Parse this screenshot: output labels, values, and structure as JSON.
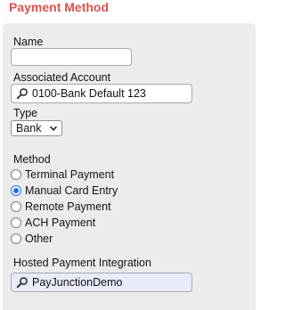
{
  "section": {
    "title": "Payment Method"
  },
  "fields": {
    "name_label": "Name",
    "name_value": "",
    "account_label": "Associated Account",
    "account_value": "0100-Bank Default 123",
    "type_label": "Type",
    "type_value": "Bank",
    "method_label": "Method",
    "methods": [
      {
        "label": "Terminal Payment",
        "checked": false
      },
      {
        "label": "Manual Card Entry",
        "checked": true
      },
      {
        "label": "Remote Payment",
        "checked": false
      },
      {
        "label": "ACH Payment",
        "checked": false
      },
      {
        "label": "Other",
        "checked": false
      }
    ],
    "integration_label": "Hosted Payment Integration",
    "integration_value": "PayJunctionDemo"
  },
  "icons": {
    "lookup": "search-icon",
    "dropdown": "chevron-down-icon"
  },
  "colors": {
    "title": "#d9534f",
    "panel_bg": "#ececec",
    "integration_field_bg": "#e8ebfa",
    "radio_accent": "#1a73e8"
  }
}
